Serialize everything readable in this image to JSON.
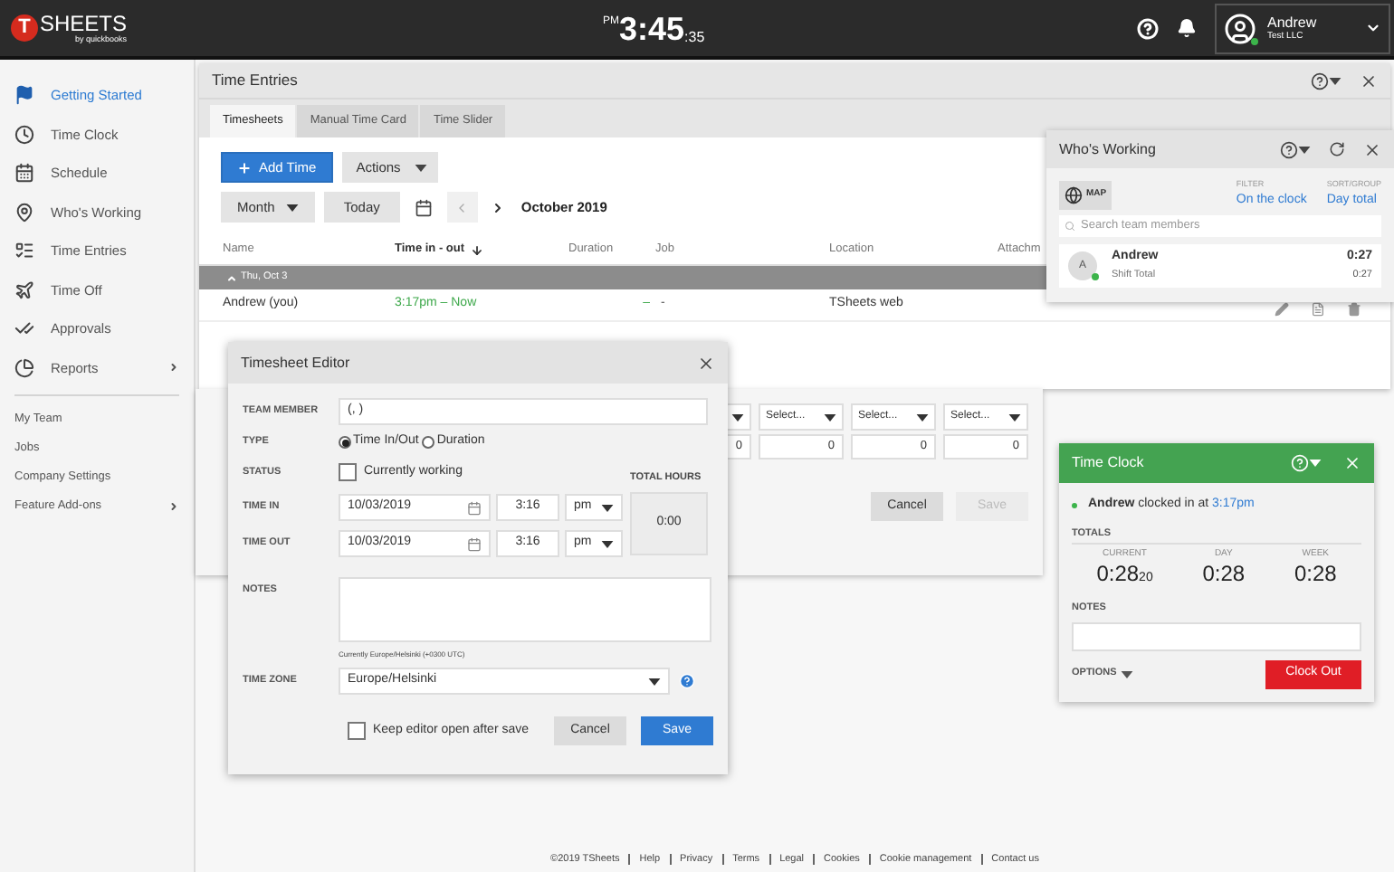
{
  "topbar": {
    "logo_letter": "T",
    "logo": "SHEETS",
    "logo_sub": "by quickbooks",
    "clock": {
      "meridiem": "PM",
      "time": "3:45",
      "seconds": ":35"
    },
    "user": {
      "name": "Andrew",
      "company": "Test LLC",
      "online": true
    }
  },
  "sidebar": {
    "items": [
      {
        "label": "Getting Started",
        "selected": true,
        "submenu": false
      },
      {
        "label": "Time Clock",
        "selected": false,
        "submenu": false
      },
      {
        "label": "Schedule",
        "selected": false,
        "submenu": false
      },
      {
        "label": "Who's Working",
        "selected": false,
        "submenu": false
      },
      {
        "label": "Time Entries",
        "selected": false,
        "submenu": false
      },
      {
        "label": "Time Off",
        "selected": false,
        "submenu": false
      },
      {
        "label": "Approvals",
        "selected": false,
        "submenu": false
      },
      {
        "label": "Reports",
        "selected": false,
        "submenu": true
      }
    ],
    "links": [
      {
        "label": "My Team",
        "submenu": false
      },
      {
        "label": "Jobs",
        "submenu": false
      },
      {
        "label": "Company Settings",
        "submenu": false
      },
      {
        "label": "Feature Add-ons",
        "submenu": true
      }
    ]
  },
  "time_entries": {
    "title": "Time Entries",
    "tabs": [
      {
        "label": "Timesheets",
        "selected": true
      },
      {
        "label": "Manual Time Card",
        "selected": false
      },
      {
        "label": "Time Slider",
        "selected": false
      }
    ],
    "add_button": "Add Time",
    "actions_button": "Actions",
    "view_button": "Month",
    "today_button": "Today",
    "period": "October 2019",
    "columns": [
      {
        "label": "Name",
        "sorted": false
      },
      {
        "label": "Time in - out",
        "sorted": true
      },
      {
        "label": "Duration",
        "sorted": false
      },
      {
        "label": "Job",
        "sorted": false
      },
      {
        "label": "Location",
        "sorted": false
      },
      {
        "label": "Attachm",
        "sorted": false
      }
    ],
    "group": {
      "label": "Thu, Oct 3",
      "expanded": true
    },
    "rows": [
      {
        "name": "Andrew (you)",
        "time": "3:17pm – Now",
        "duration": "–",
        "job": "-",
        "location": "TSheets web"
      }
    ]
  },
  "entry_form": {
    "selects": [
      "Select...",
      "Select...",
      "Select..."
    ],
    "amounts": [
      "0",
      "0",
      "0",
      "0"
    ],
    "cancel": "Cancel",
    "save": "Save",
    "save_disabled": true
  },
  "timesheet_editor": {
    "title": "Timesheet Editor",
    "team_member": {
      "label": "TEAM MEMBER",
      "value": "(, )"
    },
    "type": {
      "label": "TYPE",
      "options": [
        {
          "label": "Time In/Out",
          "selected": true
        },
        {
          "label": "Duration",
          "selected": false
        }
      ]
    },
    "status": {
      "label": "STATUS",
      "option": "Currently working",
      "checked": false
    },
    "time_in": {
      "label": "TIME IN",
      "date": "10/03/2019",
      "time": "3:16",
      "meridiem": "pm"
    },
    "time_out": {
      "label": "TIME OUT",
      "date": "10/03/2019",
      "time": "3:16",
      "meridiem": "pm"
    },
    "total_hours": {
      "label": "TOTAL HOURS",
      "value": "0:00"
    },
    "notes_label": "NOTES",
    "timezone_note": "Currently Europe/Helsinki (+0300 UTC)",
    "time_zone": {
      "label": "TIME ZONE",
      "value": "Europe/Helsinki"
    },
    "keep_open": {
      "label": "Keep editor open after save",
      "checked": false
    },
    "cancel": "Cancel",
    "save": "Save"
  },
  "whos_working": {
    "title": "Who's Working",
    "map_button": "MAP",
    "filter": {
      "label": "FILTER",
      "value": "On the clock"
    },
    "sort": {
      "label": "SORT/GROUP",
      "value": "Day total"
    },
    "search_placeholder": "Search team members",
    "members": [
      {
        "initial": "A",
        "name": "Andrew",
        "subtitle": "Shift Total",
        "total": "0:27",
        "shift_total": "0:27",
        "online": true
      }
    ]
  },
  "time_clock": {
    "title": "Time Clock",
    "status": {
      "name": "Andrew",
      "text": "clocked in at",
      "time": "3:17pm"
    },
    "totals_label": "TOTALS",
    "totals": [
      {
        "label": "CURRENT",
        "value": "0:28",
        "seconds": "20"
      },
      {
        "label": "DAY",
        "value": "0:28"
      },
      {
        "label": "WEEK",
        "value": "0:28"
      }
    ],
    "notes_label": "NOTES",
    "options": "OPTIONS",
    "clock_out": "Clock Out"
  },
  "footer": [
    "©2019 TSheets",
    "Help",
    "Privacy",
    "Terms",
    "Legal",
    "Cookies",
    "Cookie management",
    "Contact us"
  ]
}
